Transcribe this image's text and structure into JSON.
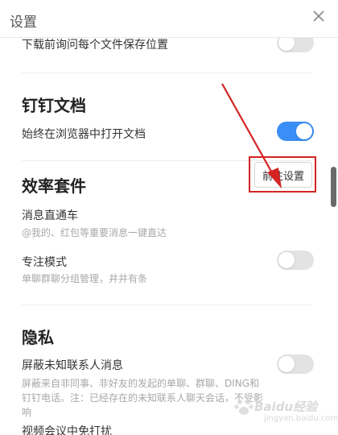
{
  "window": {
    "title": "设置"
  },
  "settings": {
    "top_partial_label": "下载前询问每个文件保存位置",
    "dingtalk_docs": {
      "title": "钉钉文档",
      "open_in_browser_label": "始终在浏览器中打开文档",
      "open_in_browser_on": true
    },
    "efficiency": {
      "title": "效率套件",
      "express_label": "消息直通车",
      "express_desc": "@我的、红包等重要消息一键直达",
      "express_button": "前往设置",
      "focus_label": "专注模式",
      "focus_desc": "单聊群聊分组管理，井井有条",
      "focus_on": false
    },
    "privacy": {
      "title": "隐私",
      "block_label": "屏蔽未知联系人消息",
      "block_desc_line1": "屏蔽来自非同事、非好友的发起的单聊、群聊、DING和",
      "block_desc_line2": "钉钉电话。注：已经存在的未知联系人聊天会话，不受影",
      "block_desc_line3": "响",
      "block_on": false,
      "next_partial_label": "视频会议中免打扰"
    },
    "download_ask_on": false
  },
  "watermark": {
    "text": "Baidu经验",
    "sub": "jingyan.baidu.com"
  },
  "colors": {
    "toggle_on": "#3b8ef5",
    "toggle_off": "#e3e3e3",
    "annotation_red": "#d32424"
  }
}
